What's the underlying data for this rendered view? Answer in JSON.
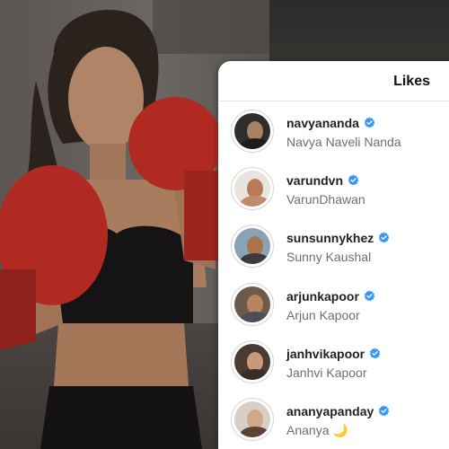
{
  "background": {
    "subject": "woman in boxing gloves and black sports top",
    "glove_color": "#b02a22"
  },
  "likes_panel": {
    "title": "Likes",
    "verified_color": "#3897f0",
    "users": [
      {
        "username": "navyananda",
        "full_name": "Navya Naveli Nanda",
        "verified": true,
        "avatar_icon": "profile-photo",
        "tone": [
          "#2e2e2e",
          "#a98266",
          "#1d1d1d"
        ]
      },
      {
        "username": "varundvn",
        "full_name": "VarunDhawan",
        "verified": true,
        "avatar_icon": "profile-photo",
        "tone": [
          "#e8e4df",
          "#b77b58",
          "#c08b69"
        ]
      },
      {
        "username": "sunsunnykhez",
        "full_name": "Sunny Kaushal",
        "verified": true,
        "avatar_icon": "profile-photo",
        "tone": [
          "#8aa3b4",
          "#a8734f",
          "#3e3a37"
        ]
      },
      {
        "username": "arjunkapoor",
        "full_name": "Arjun Kapoor",
        "verified": true,
        "avatar_icon": "profile-photo",
        "tone": [
          "#6c5b4b",
          "#b98461",
          "#4a4d5a"
        ]
      },
      {
        "username": "janhvikapoor",
        "full_name": "Janhvi Kapoor",
        "verified": true,
        "avatar_icon": "profile-photo",
        "tone": [
          "#4b3a31",
          "#c99a7a",
          "#3a2b25"
        ]
      },
      {
        "username": "ananyapanday",
        "full_name": "Ananya 🌙",
        "verified": true,
        "avatar_icon": "profile-photo",
        "tone": [
          "#d8cfc7",
          "#d2a88a",
          "#5b4336"
        ]
      }
    ]
  }
}
